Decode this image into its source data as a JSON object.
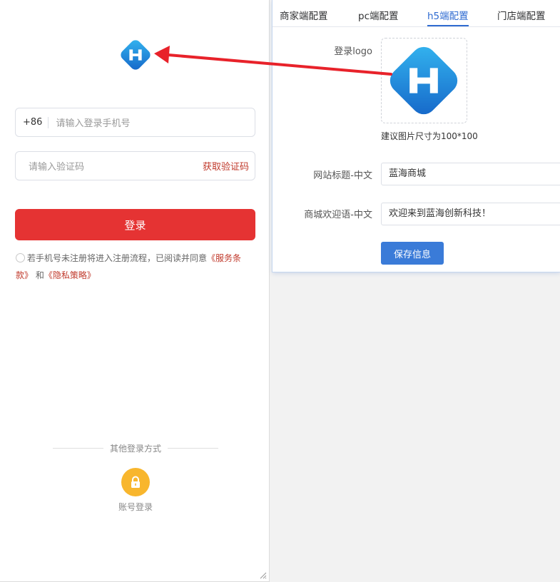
{
  "phone": {
    "country_code": "+86",
    "phone_placeholder": "请输入登录手机号",
    "code_placeholder": "请输入验证码",
    "get_code": "获取验证码",
    "login": "登录",
    "agree_text": "若手机号未注册将进入注册流程，已阅读并同意",
    "service_terms": "《服务条款》",
    "and": "和",
    "privacy_policy": "《隐私策略》",
    "other_login": "其他登录方式",
    "account_login": "账号登录"
  },
  "panel": {
    "tabs": [
      {
        "label": "商家端配置"
      },
      {
        "label": "pc端配置"
      },
      {
        "label": "h5端配置",
        "active": true
      },
      {
        "label": "门店端配置"
      }
    ],
    "logo_label": "登录logo",
    "logo_hint": "建议图片尺寸为100*100",
    "site_title_label": "网站标题-中文",
    "site_title_value": "蓝海商城",
    "welcome_label": "商城欢迎语-中文",
    "welcome_value": "欢迎来到蓝海创新科技！",
    "save": "保存信息"
  },
  "colors": {
    "primary_red": "#e53333",
    "link_red": "#c0392b",
    "tab_active": "#2f6bd1",
    "save_blue": "#3a7bd8",
    "account_icon": "#f8b62d",
    "arrow": "#e8222a"
  }
}
